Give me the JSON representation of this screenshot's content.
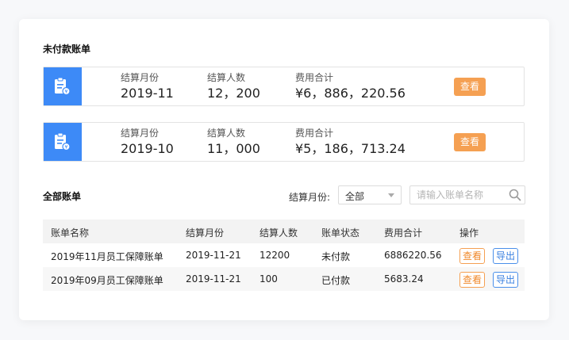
{
  "unpaid": {
    "title": "未付款账单",
    "bills": [
      {
        "month_label": "结算月份",
        "month": "2019-11",
        "people_label": "结算人数",
        "people": "12，200",
        "cost_label": "费用合计",
        "cost": "¥6，886，220.56",
        "view_label": "查看"
      },
      {
        "month_label": "结算月份",
        "month": "2019-10",
        "people_label": "结算人数",
        "people": "11，000",
        "cost_label": "费用合计",
        "cost": "¥5，186，713.24",
        "view_label": "查看"
      }
    ]
  },
  "all": {
    "title": "全部账单",
    "filter_label": "结算月份:",
    "select_value": "全部",
    "search_placeholder": "请输入账单名称",
    "columns": [
      "账单名称",
      "结算月份",
      "结算人数",
      "账单状态",
      "费用合计",
      "操作"
    ],
    "rows": [
      {
        "name": "2019年11月员工保障账单",
        "month": "2019-11-21",
        "people": "12200",
        "status": "未付款",
        "cost": "6886220.56",
        "view": "查看",
        "export": "导出"
      },
      {
        "name": "2019年09月员工保障账单",
        "month": "2019-11-21",
        "people": "100",
        "status": "已付款",
        "cost": "5683.24",
        "view": "查看",
        "export": "导出"
      }
    ]
  },
  "colors": {
    "accent_blue": "#3d8af7",
    "accent_orange": "#f5a052"
  }
}
